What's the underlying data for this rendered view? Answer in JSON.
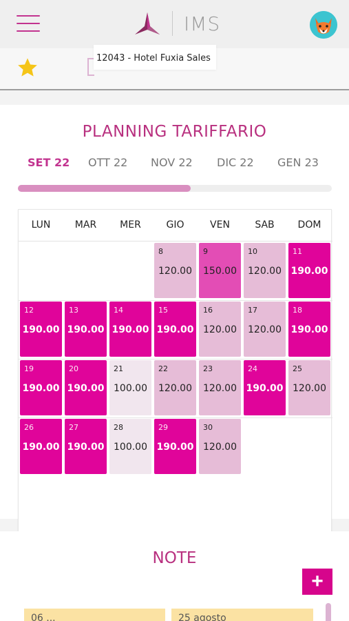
{
  "header": {
    "app_name": "IMS",
    "hotel_label": "12043 - Hotel Fuxia Sales",
    "colors": {
      "accent": "#c2338f",
      "hamburger": "#c2338f"
    },
    "icons": [
      "hamburger-icon",
      "ims-logo-icon",
      "fox-avatar-icon",
      "star-icon",
      "hotel-icon"
    ]
  },
  "planning": {
    "title": "PLANNING TARIFFARIO",
    "months": [
      {
        "label": "SET 22",
        "active": true
      },
      {
        "label": "OTT 22",
        "active": false
      },
      {
        "label": "NOV 22",
        "active": false
      },
      {
        "label": "DIC 22",
        "active": false
      },
      {
        "label": "GEN 23",
        "active": false
      }
    ],
    "scroll_progress": 0.55,
    "weekdays": [
      "LUN",
      "MAR",
      "MER",
      "GIO",
      "VEN",
      "SAB",
      "DOM"
    ],
    "price_colors": {
      "190.00": "#e0049a",
      "150.00": "#e34db5",
      "120.00": "#e6bcd7",
      "100.00": "#f1e6ee"
    },
    "days": [
      {
        "day": "8",
        "price": "120.00",
        "level": "mid"
      },
      {
        "day": "9",
        "price": "150.00",
        "level": "peak"
      },
      {
        "day": "10",
        "price": "120.00",
        "level": "mid"
      },
      {
        "day": "11",
        "price": "190.00",
        "level": "high"
      },
      {
        "day": "12",
        "price": "190.00",
        "level": "high"
      },
      {
        "day": "13",
        "price": "190.00",
        "level": "high"
      },
      {
        "day": "14",
        "price": "190.00",
        "level": "high"
      },
      {
        "day": "15",
        "price": "190.00",
        "level": "high"
      },
      {
        "day": "16",
        "price": "120.00",
        "level": "mid"
      },
      {
        "day": "17",
        "price": "120.00",
        "level": "mid"
      },
      {
        "day": "18",
        "price": "190.00",
        "level": "high"
      },
      {
        "day": "19",
        "price": "190.00",
        "level": "high"
      },
      {
        "day": "20",
        "price": "190.00",
        "level": "high"
      },
      {
        "day": "21",
        "price": "100.00",
        "level": "low"
      },
      {
        "day": "22",
        "price": "120.00",
        "level": "mid"
      },
      {
        "day": "23",
        "price": "120.00",
        "level": "mid"
      },
      {
        "day": "24",
        "price": "190.00",
        "level": "high"
      },
      {
        "day": "25",
        "price": "120.00",
        "level": "mid"
      },
      {
        "day": "26",
        "price": "190.00",
        "level": "high"
      },
      {
        "day": "27",
        "price": "190.00",
        "level": "high"
      },
      {
        "day": "28",
        "price": "100.00",
        "level": "low"
      },
      {
        "day": "29",
        "price": "190.00",
        "level": "high"
      },
      {
        "day": "30",
        "price": "120.00",
        "level": "mid"
      }
    ],
    "status_color": "#21e065"
  },
  "notes": {
    "title": "NOTE",
    "add_label": "+",
    "items": [
      "06 ...",
      "25 agosto"
    ]
  }
}
